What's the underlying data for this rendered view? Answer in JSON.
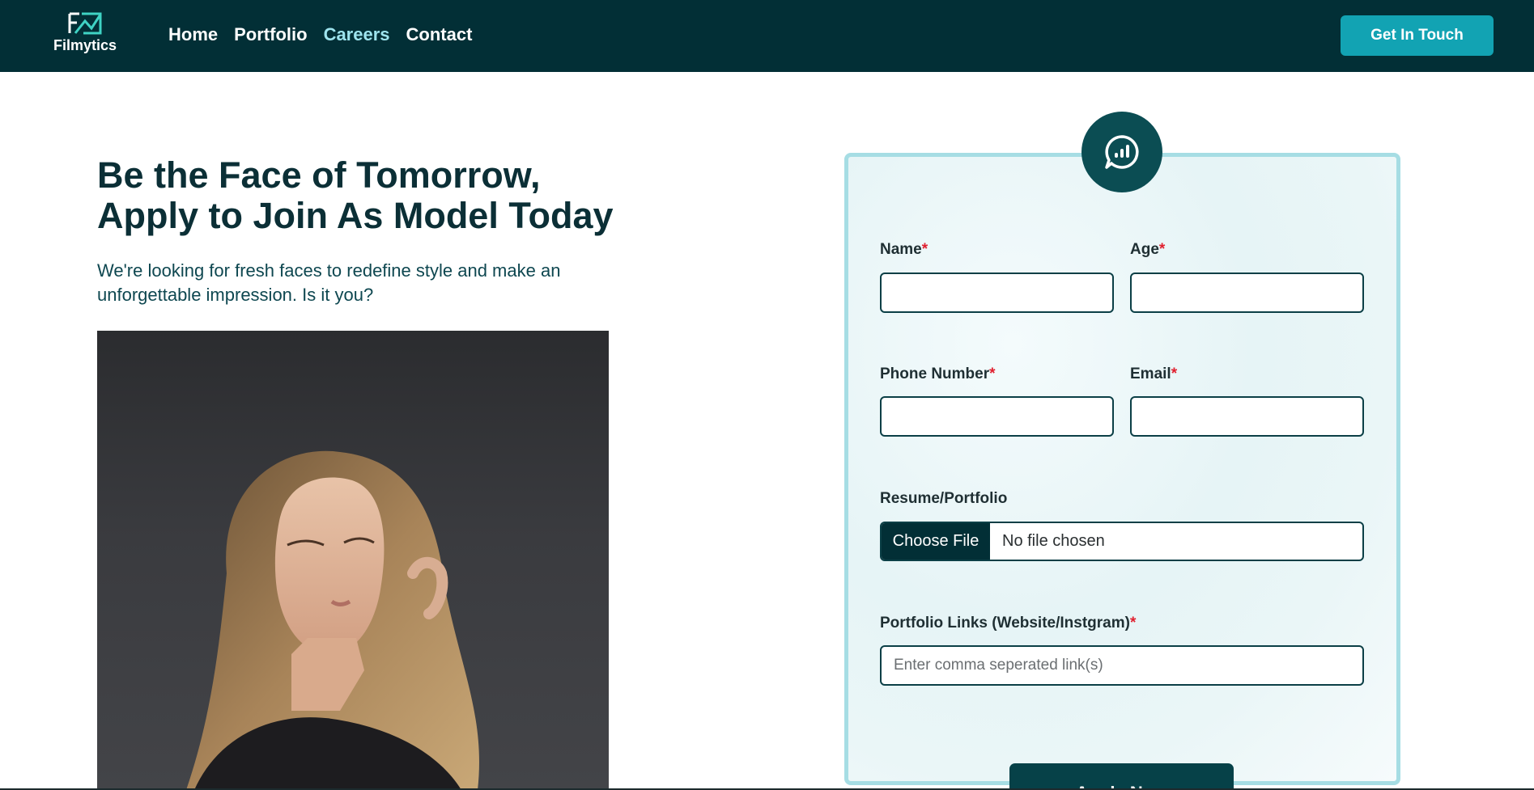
{
  "header": {
    "logo_text": "Filmytics",
    "nav": [
      {
        "label": "Home",
        "active": false
      },
      {
        "label": "Portfolio",
        "active": false
      },
      {
        "label": "Careers",
        "active": true
      },
      {
        "label": "Contact",
        "active": false
      }
    ],
    "cta_label": "Get In Touch"
  },
  "hero": {
    "title_line1": "Be the Face of Tomorrow,",
    "title_line2": "Apply to Join As Model Today",
    "subtitle": "We're looking for fresh faces to redefine style and make an unforgettable impression. Is it you?"
  },
  "form": {
    "badge_icon": "chat-analytics-icon",
    "name_label": "Name",
    "age_label": "Age",
    "phone_label": "Phone Number",
    "email_label": "Email",
    "resume_label": "Resume/Portfolio",
    "file_button_label": "Choose File",
    "file_status": "No file chosen",
    "links_label": "Portfolio Links (Website/Instgram)",
    "links_placeholder": "Enter comma seperated link(s)",
    "required_mark": "*",
    "submit_label": "Apply Now"
  },
  "colors": {
    "nav_bg": "#022f36",
    "accent": "#12a3b3",
    "active_link": "#9ee4ee",
    "required": "#e0202f"
  }
}
